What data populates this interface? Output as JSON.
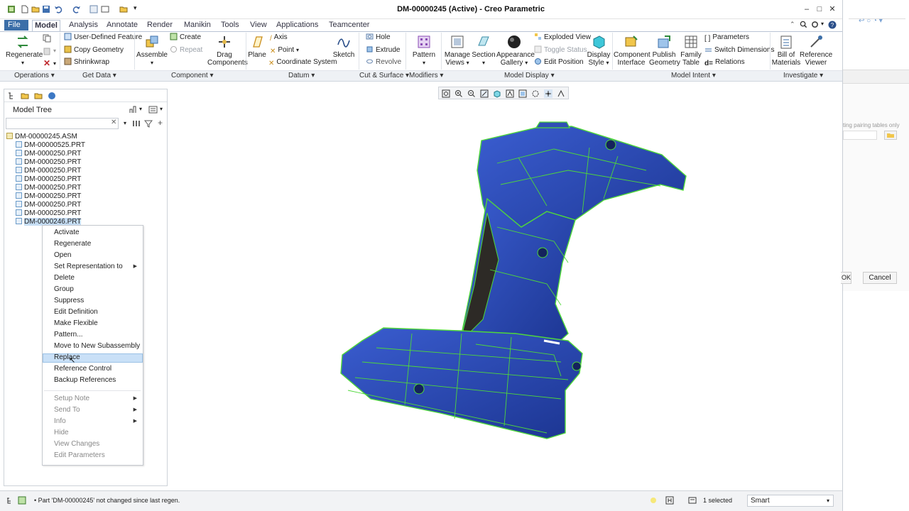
{
  "window": {
    "title": "DM-00000245 (Active) - Creo Parametric"
  },
  "menu": {
    "file": "File",
    "tabs": [
      "Model",
      "Analysis",
      "Annotate",
      "Render",
      "Manikin",
      "Tools",
      "View",
      "Applications",
      "Teamcenter"
    ]
  },
  "ribbon": {
    "regenerate": "Regenerate",
    "udf": "User-Defined Feature",
    "copy_geometry": "Copy Geometry",
    "shrinkwrap": "Shrinkwrap",
    "assemble": "Assemble",
    "create": "Create",
    "repeat": "Repeat",
    "drag_components": "Drag Components",
    "plane": "Plane",
    "axis": "Axis",
    "point": "Point",
    "coordinate_system": "Coordinate System",
    "sketch": "Sketch",
    "hole": "Hole",
    "extrude": "Extrude",
    "revolve": "Revolve",
    "pattern": "Pattern",
    "manage_views": "Manage Views",
    "section": "Section",
    "appearance_gallery": "Appearance Gallery",
    "exploded_view": "Exploded View",
    "toggle_status": "Toggle Status",
    "edit_position": "Edit Position",
    "display_style": "Display Style",
    "component_interface": "Component Interface",
    "publish_geometry": "Publish Geometry",
    "family_table": "Family Table",
    "parameters": "Parameters",
    "switch_dimensions": "Switch Dimensions",
    "relations": "Relations",
    "bill_of_materials": "Bill of Materials",
    "reference_viewer": "Reference Viewer"
  },
  "groups": [
    "Operations ▾",
    "Get Data ▾",
    "Component ▾",
    "Datum ▾",
    "Cut & Surface ▾",
    "Modifiers ▾",
    "Model Display ▾",
    "Model Intent ▾",
    "Investigate ▾"
  ],
  "model_tree": {
    "title": "Model Tree",
    "search_value": "",
    "root": "DM-00000245.ASM",
    "items": [
      "DM-00000525.PRT",
      "DM-0000250.PRT",
      "DM-0000250.PRT",
      "DM-0000250.PRT",
      "DM-0000250.PRT",
      "DM-0000250.PRT",
      "DM-0000250.PRT",
      "DM-0000250.PRT",
      "DM-0000250.PRT",
      "DM-0000246.PRT"
    ]
  },
  "context_menu": {
    "items": [
      "Activate",
      "Regenerate",
      "Open",
      "Set Representation to",
      "Delete",
      "Group",
      "Suppress",
      "Edit Definition",
      "Make Flexible",
      "Pattern...",
      "Move to New Subassembly",
      "Replace",
      "Reference Control",
      "Backup References"
    ],
    "items2": [
      "Setup Note",
      "Send To",
      "Info",
      "Hide",
      "View Changes",
      "Edit Parameters"
    ],
    "highlighted": "Replace"
  },
  "right_panel": {
    "hint": "ting pairing tables only",
    "ok": "OK",
    "cancel": "Cancel"
  },
  "status": {
    "message": "• Part 'DM-00000245' not changed since last regen.",
    "selected": "1 selected",
    "filter": "Smart"
  },
  "colors": {
    "accent": "#3b6ea8",
    "part_blue": "#2f4fb5",
    "edges_green": "#4fd83a",
    "highlight": "#c9e0f7"
  }
}
